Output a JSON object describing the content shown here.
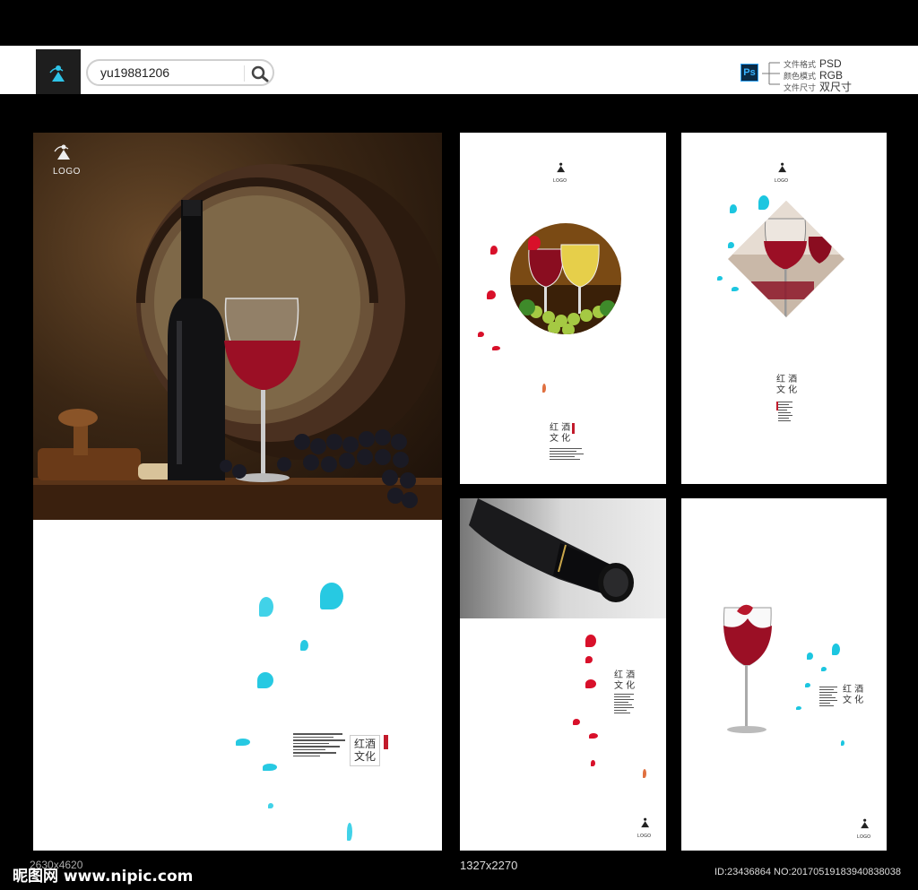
{
  "header": {
    "search_value": "yu19881206",
    "ps_label": "Ps",
    "specs": [
      {
        "key": "文件格式",
        "value": "PSD"
      },
      {
        "key": "颜色模式",
        "value": "RGB"
      },
      {
        "key": "文件尺寸",
        "value": "双尺寸"
      }
    ],
    "logo_text": "LOGO"
  },
  "panels": {
    "big": {
      "logo": "LOGO",
      "title_1": "红",
      "title_2": "酒",
      "title_3": "文",
      "title_4": "化"
    },
    "a": {
      "logo": "LOGO",
      "title_line1": "红 酒",
      "title_line2": "文 化"
    },
    "b": {
      "logo": "LOGO",
      "title_line1": "红 酒",
      "title_line2": "文 化"
    },
    "c": {
      "logo": "LOGO",
      "title_line1": "红 酒",
      "title_line2": "文 化"
    },
    "d": {
      "logo": "LOGO",
      "title_line1": "红 酒",
      "title_line2": "文 化"
    }
  },
  "footer": {
    "site": "昵图网 www.nipic.com",
    "dim_left": "2630x4620",
    "dim_right": "1327x2270",
    "id": "ID:23436864 NO:20170519183940838038"
  },
  "colors": {
    "wine": "#9b0f25",
    "cyan": "#1cc6e0",
    "red": "#d8102a"
  }
}
